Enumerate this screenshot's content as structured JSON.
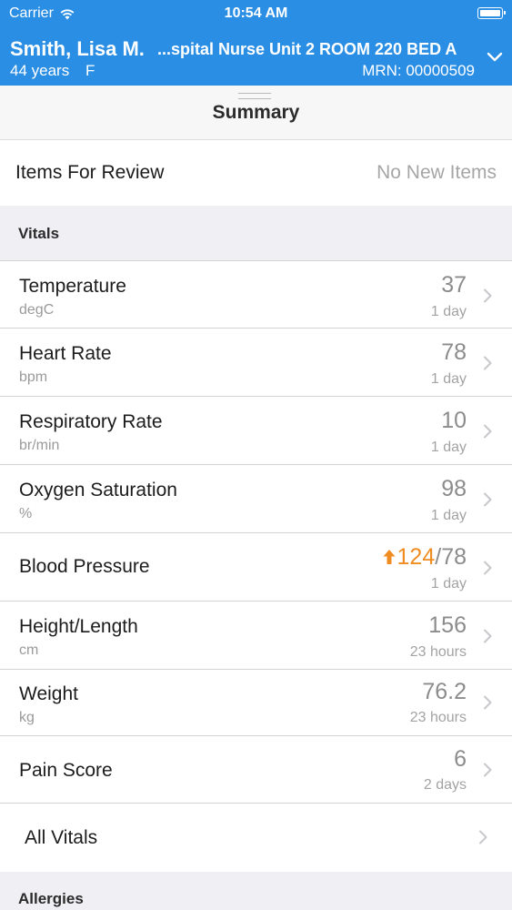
{
  "status_bar": {
    "carrier": "Carrier",
    "time": "10:54 AM"
  },
  "patient": {
    "name": "Smith, Lisa M.",
    "location": "...spital Nurse Unit 2 ROOM 220 BED A",
    "age": "44 years",
    "sex": "F",
    "mrn": "MRN: 00000509"
  },
  "summary": {
    "title": "Summary"
  },
  "review": {
    "label": "Items For Review",
    "status": "No New Items"
  },
  "sections": {
    "vitals": "Vitals",
    "allergies": "Allergies"
  },
  "vitals": [
    {
      "name": "Temperature",
      "unit": "degC",
      "value": "37",
      "age": "1 day"
    },
    {
      "name": "Heart Rate",
      "unit": "bpm",
      "value": "78",
      "age": "1 day"
    },
    {
      "name": "Respiratory Rate",
      "unit": "br/min",
      "value": "10",
      "age": "1 day"
    },
    {
      "name": "Oxygen Saturation",
      "unit": "%",
      "value": "98",
      "age": "1 day"
    },
    {
      "name": "Blood Pressure",
      "unit": "",
      "value_high": "124",
      "value_sep": "/",
      "value_low": "78",
      "age": "1 day"
    },
    {
      "name": "Height/Length",
      "unit": "cm",
      "value": "156",
      "age": "23 hours"
    },
    {
      "name": "Weight",
      "unit": "kg",
      "value": "76.2",
      "age": "23 hours"
    },
    {
      "name": "Pain Score",
      "unit": "",
      "value": "6",
      "age": "2 days"
    }
  ],
  "all_vitals": {
    "label": "All Vitals"
  },
  "colors": {
    "header": "#2a8ee4",
    "abnormal_high": "#ef8d22"
  }
}
